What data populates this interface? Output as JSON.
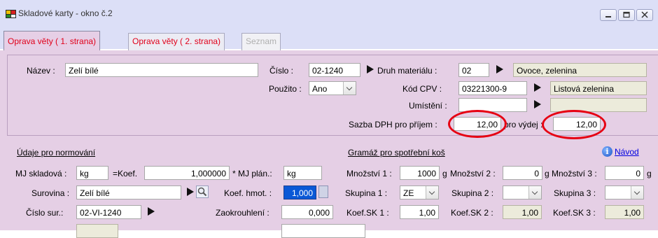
{
  "window": {
    "title": "Skladové karty - okno č.2"
  },
  "tabs": [
    {
      "label": "Oprava věty ( 1. strana)",
      "state": "active"
    },
    {
      "label": "Oprava věty ( 2. strana)",
      "state": "normal"
    },
    {
      "label": "Seznam",
      "state": "disabled"
    }
  ],
  "top": {
    "nazev_label": "Název :",
    "nazev_value": "Zelí bílé",
    "cislo_label": "Číslo :",
    "cislo_value": "02-1240",
    "druh_label": "Druh materiálu :",
    "druh_value": "02",
    "druh_name": "Ovoce, zelenina",
    "pouzito_label": "Použito :",
    "pouzito_value": "Ano",
    "cpv_label": "Kód CPV :",
    "cpv_value": "03221300-9",
    "cpv_name": "Listová zelenina",
    "umisteni_label": "Umístění :",
    "umisteni_value": "",
    "umisteni_name": "",
    "dph_prijem_label": "Sazba DPH pro příjem :",
    "dph_prijem_value": "12,00",
    "dph_vydej_label": "pro výdej :",
    "dph_vydej_value": "12,00"
  },
  "normovani": {
    "heading": "Údaje pro normování",
    "mj_sklad_label": "MJ skladová :",
    "mj_sklad_value": "kg",
    "koef_label": "=Koef.",
    "koef_value": "1,000000",
    "mj_plan_label": "* MJ plán.:",
    "mj_plan_value": "kg",
    "surovina_label": "Surovina :",
    "surovina_value": "Zelí bílé",
    "koef_hmot_label": "Koef. hmot. :",
    "koef_hmot_value": "1,000",
    "cislo_sur_label": "Číslo sur.:",
    "cislo_sur_value": "02-VI-1240",
    "zaokrouhleni_label": "Zaokrouhlení :",
    "zaokrouhleni_value": "0,000"
  },
  "gramaz": {
    "heading": "Gramáž pro spotřební koš",
    "help_label": "Návod",
    "mnozstvi1_label": "Množství 1 :",
    "mnozstvi1_value": "1000",
    "mnozstvi1_unit": "g",
    "mnozstvi2_label": "Množství 2 :",
    "mnozstvi2_value": "0",
    "mnozstvi2_unit": "g",
    "mnozstvi3_label": "Množství 3 :",
    "mnozstvi3_value": "0",
    "mnozstvi3_unit": "g",
    "skupina1_label": "Skupina 1 :",
    "skupina1_value": "ZE",
    "skupina2_label": "Skupina 2 :",
    "skupina2_value": "",
    "skupina3_label": "Skupina 3 :",
    "skupina3_value": "",
    "koefsk1_label": "Koef.SK 1 :",
    "koefsk1_value": "1,00",
    "koefsk2_label": "Koef.SK 2 :",
    "koefsk2_value": "1,00",
    "koefsk3_label": "Koef.SK 3 :",
    "koefsk3_value": "1,00"
  },
  "colors": {
    "panel": "#e5cfe5",
    "tab_text": "#e0001a",
    "highlight_ring": "#e60012",
    "selection": "#0a58d6"
  }
}
